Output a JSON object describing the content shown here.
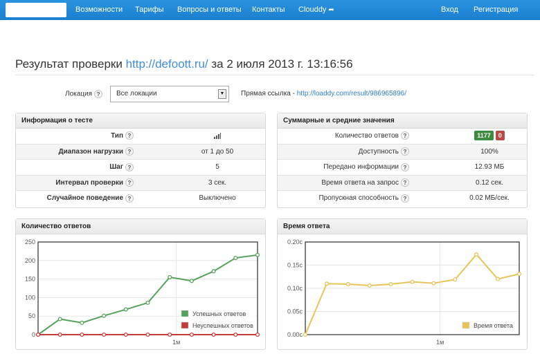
{
  "nav": {
    "items": [
      "Возможности",
      "Тарифы",
      "Вопросы и ответы",
      "Контакты",
      "Clouddy"
    ],
    "login": "Вход",
    "register": "Регистрация"
  },
  "title": {
    "prefix": "Результат проверки",
    "url": "http://defoott.ru/",
    "suffix": "за 2 июля 2013 г. 13:16:56"
  },
  "location": {
    "label": "Локация",
    "selected": "Все локации",
    "direct_link_label": "Прямая ссылка -",
    "direct_link_url": "http://loaddy.com/result/986965896/"
  },
  "test_info": {
    "heading": "Информация о тесте",
    "rows": [
      {
        "label": "Тип",
        "value": ""
      },
      {
        "label": "Диапазон нагрузки",
        "value": "от 1 до 50"
      },
      {
        "label": "Шаг",
        "value": "5"
      },
      {
        "label": "Интервал проверки",
        "value": "3 сек."
      },
      {
        "label": "Случайное поведение",
        "value": "Выключено"
      }
    ]
  },
  "summary": {
    "heading": "Суммарные и средние значения",
    "responses_ok": "1177",
    "responses_fail": "0",
    "rows": [
      {
        "label": "Количество ответов",
        "value": ""
      },
      {
        "label": "Доступность",
        "value": "100%"
      },
      {
        "label": "Передано информации",
        "value": "12.93 МБ"
      },
      {
        "label": "Время ответа на запрос",
        "value": "0.12 сек."
      },
      {
        "label": "Пропускная способность",
        "value": "0.02 МБ/сек."
      }
    ]
  },
  "help_glyph": "?",
  "chart_data": [
    {
      "type": "line",
      "title": "Количество ответов",
      "x_tick_label": "1м",
      "ylim": [
        0,
        250
      ],
      "yticks": [
        0,
        50,
        100,
        150,
        200,
        250
      ],
      "grid": true,
      "legend": "bottom-right",
      "series": [
        {
          "name": "Успешных ответов",
          "color": "#55a35a",
          "values": [
            0,
            42,
            32,
            51,
            68,
            86,
            155,
            145,
            171,
            207,
            215
          ]
        },
        {
          "name": "Неуспешных ответов",
          "color": "#c43b3b",
          "values": [
            0,
            0,
            0,
            0,
            0,
            0,
            0,
            0,
            0,
            0,
            0
          ]
        }
      ]
    },
    {
      "type": "line",
      "title": "Время ответа",
      "x_tick_label": "1м",
      "ylim": [
        0,
        0.2
      ],
      "yticks": [
        "0.00c",
        "0.05c",
        "0.10c",
        "0.15c",
        "0.20c"
      ],
      "grid": true,
      "legend": "bottom-right",
      "series": [
        {
          "name": "Время ответа",
          "color": "#e8c35a",
          "values": [
            0,
            0.11,
            0.109,
            0.106,
            0.109,
            0.114,
            0.111,
            0.119,
            0.173,
            0.12,
            0.131
          ]
        }
      ]
    }
  ]
}
